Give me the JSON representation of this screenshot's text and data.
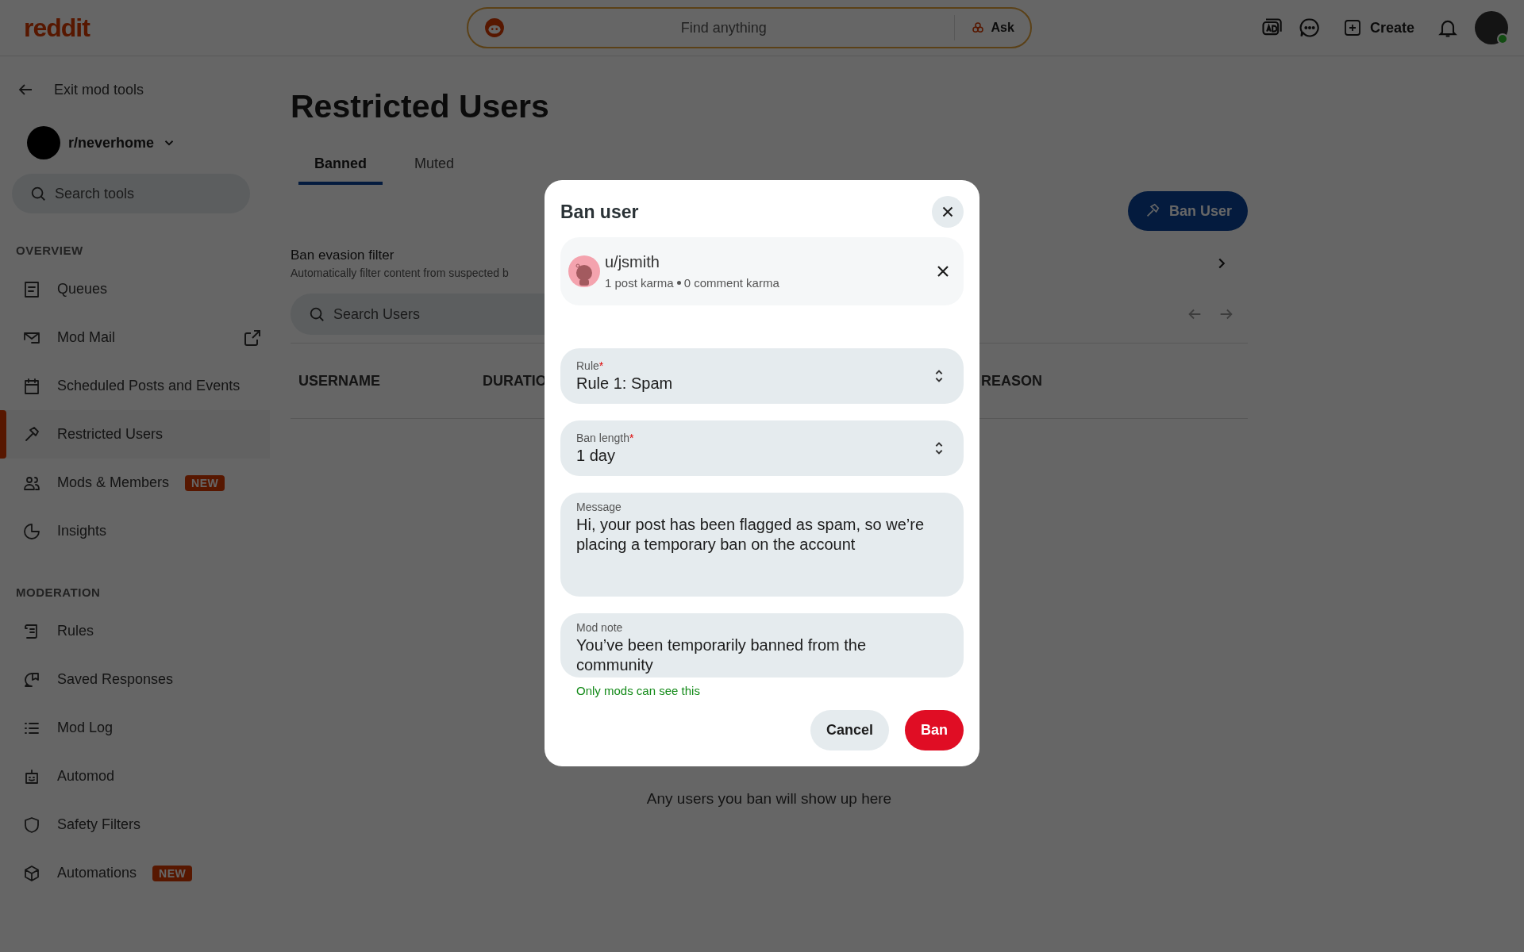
{
  "header": {
    "logo": "reddit",
    "search": {
      "placeholder": "Find anything"
    },
    "ask": "Ask",
    "create": "Create"
  },
  "sidebar": {
    "back": "Exit mod tools",
    "community": "r/neverhome",
    "search": {
      "placeholder": "Search tools"
    },
    "sections": [
      {
        "title": "OVERVIEW",
        "items": [
          {
            "label": "Queues",
            "selected": false
          },
          {
            "label": "Mod Mail",
            "selected": false,
            "external": true
          },
          {
            "label": "Scheduled Posts and Events",
            "selected": false
          },
          {
            "label": "Restricted Users",
            "selected": true
          },
          {
            "label": "Mods & Members",
            "selected": false,
            "badge": "NEW"
          },
          {
            "label": "Insights",
            "selected": false
          }
        ]
      },
      {
        "title": "MODERATION",
        "items": [
          {
            "label": "Rules",
            "selected": false
          },
          {
            "label": "Saved Responses",
            "selected": false
          },
          {
            "label": "Mod Log",
            "selected": false
          },
          {
            "label": "Automod",
            "selected": false
          },
          {
            "label": "Safety Filters",
            "selected": false
          },
          {
            "label": "Automations",
            "selected": false,
            "badge": "NEW"
          }
        ]
      }
    ]
  },
  "page": {
    "title": "Restricted Users",
    "tabs": [
      {
        "label": "Banned",
        "selected": true
      },
      {
        "label": "Muted",
        "selected": false
      }
    ],
    "ban_button": "Ban User",
    "filter": {
      "title": "Ban evasion filter",
      "description": "Automatically filter content from suspected b"
    },
    "search": {
      "placeholder": "Search Users"
    },
    "columns": [
      "USERNAME",
      "DURATIO",
      "REASON"
    ],
    "empty": "Any users you ban will show up here"
  },
  "modal": {
    "title": "Ban user",
    "user": {
      "name": "u/jsmith",
      "post_karma": "1 post karma",
      "comment_karma": "0 comment karma"
    },
    "fields": [
      {
        "kind": "select",
        "label": "Rule",
        "required_mark": "*",
        "value": "Rule 1: Spam"
      },
      {
        "kind": "select",
        "label": "Ban length",
        "required_mark": "*",
        "value": "1 day"
      },
      {
        "kind": "textarea",
        "label": "Message",
        "value": "Hi, your post has been flagged as spam, so we’re placing a temporary ban on the account"
      },
      {
        "kind": "note",
        "label": "Mod note",
        "value": "You’ve been temporarily banned from the community",
        "hint": "Only mods can see this"
      }
    ],
    "buttons": [
      {
        "label": "Cancel",
        "kind": "secondary"
      },
      {
        "label": "Ban",
        "kind": "primary"
      }
    ]
  }
}
